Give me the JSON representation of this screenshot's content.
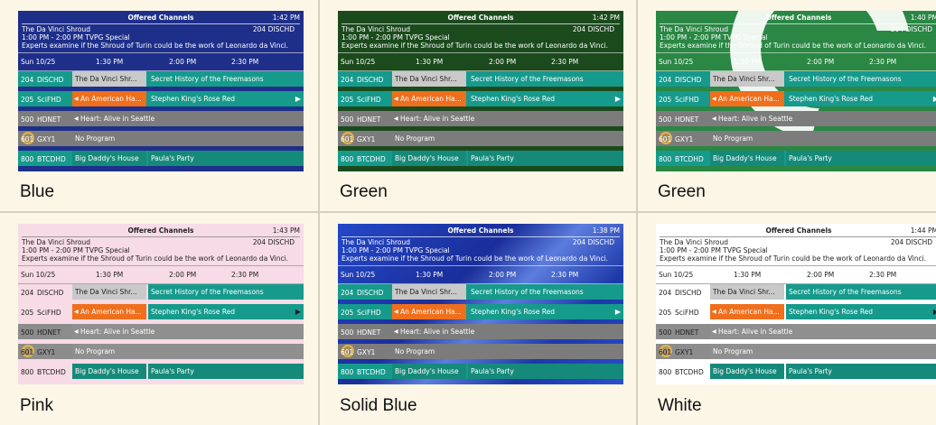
{
  "guide": {
    "header_title": "Offered Channels",
    "show_title": "The Da Vinci Shroud",
    "show_channel": "204 DISCHD",
    "show_time": "1:00 PM - 2:00 PM   TVPG  Special",
    "show_desc": "Experts examine if the Shroud of Turin could be the work of Leonardo da Vinci.",
    "date": "Sun 10/25",
    "slots": [
      "1:30 PM",
      "2:00 PM",
      "2:30 PM"
    ],
    "rows": [
      {
        "num": "204",
        "name": "DISCHD",
        "programs": [
          "The Da Vinci Shr...",
          "Secret History of the Freemasons"
        ]
      },
      {
        "num": "205",
        "name": "SciFHD",
        "programs": [
          "An American Ha...",
          "Stephen King's Rose Red"
        ]
      },
      {
        "num": "500",
        "name": "HDNET",
        "programs": [
          "Heart: Alive in Seattle"
        ]
      },
      {
        "num": "601",
        "name": "GXY1",
        "programs": [
          "No Program"
        ]
      },
      {
        "num": "800",
        "name": "BTCDHD",
        "programs": [
          "Big Daddy's House",
          "Paula's Party"
        ]
      }
    ]
  },
  "themes": [
    {
      "label": "Blue",
      "time": "1:42 PM"
    },
    {
      "label": "Green",
      "time": "1:42 PM"
    },
    {
      "label": "Green",
      "time": "1:40 PM"
    },
    {
      "label": "Pink",
      "time": "1:43 PM"
    },
    {
      "label": "Solid  Blue",
      "time": "1:38 PM"
    },
    {
      "label": "White",
      "time": "1:44 PM"
    }
  ],
  "colors": {
    "selected": "#c9c9c9",
    "teal": "#169a8c",
    "orange": "#ef6f1c",
    "gray": "#7c7c7c",
    "dark_teal": "#168a7a"
  }
}
